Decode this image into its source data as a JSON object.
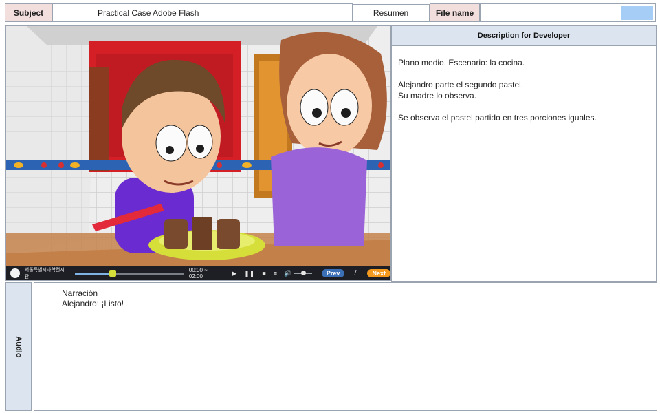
{
  "header": {
    "subject_label": "Subject",
    "subject_value": "Practical Case Adobe Flash",
    "resumen_label": "Resumen",
    "filename_label": "File name",
    "filename_value": ""
  },
  "player": {
    "logo_text": "서울특별시과학전시관",
    "time": "00:00 ~ 02:00",
    "progress": 0.35,
    "volume": 0.5,
    "prev_label": "Prev",
    "separator": "/",
    "next_label": "Next",
    "play_icon": "play-icon",
    "pause_icon": "pause-icon",
    "stop_icon": "stop-icon",
    "menu_icon": "menu-icon",
    "volume_icon": "volume-icon"
  },
  "description": {
    "title": "Description for Developer",
    "lines": [
      "Plano medio. Escenario: la cocina.",
      "Alejandro parte el segundo pastel.",
      "Su madre lo observa.",
      "Se observa el pastel partido en tres porciones iguales."
    ]
  },
  "audio": {
    "label": "Audio",
    "lines": [
      "Narración",
      "Alejandro: ¡Listo!"
    ]
  },
  "colors": {
    "header_label_bg": "#f3dede",
    "panel_header_bg": "#dbe4ef",
    "border": "#9aa4b0",
    "player_bar": "#1d1f24",
    "next_button": "#f39a1e",
    "prev_button": "#3b6fb6",
    "progress_fill": "#7fb3e6",
    "progress_thumb": "#d6df3a"
  }
}
